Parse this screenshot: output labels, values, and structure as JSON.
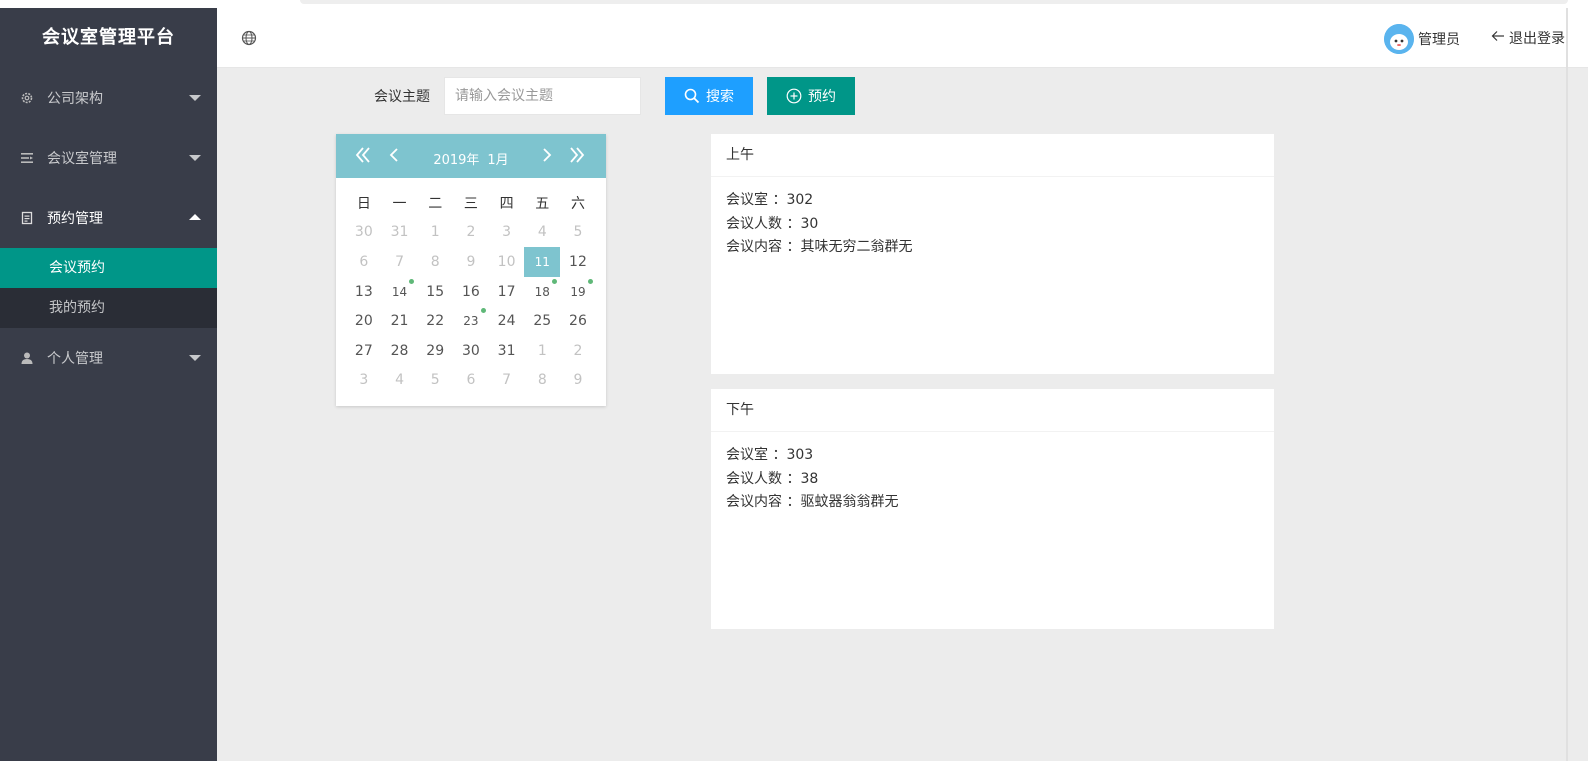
{
  "app": {
    "title": "会议室管理平台"
  },
  "sidebar": {
    "items": [
      {
        "label": "公司架构",
        "icon": "gear-icon"
      },
      {
        "label": "会议室管理",
        "icon": "list-icon"
      },
      {
        "label": "预约管理",
        "icon": "clipboard-icon",
        "expanded": true,
        "children": [
          {
            "label": "会议预约",
            "selected": true
          },
          {
            "label": "我的预约"
          }
        ]
      },
      {
        "label": "个人管理",
        "icon": "user-icon"
      }
    ]
  },
  "header": {
    "globe_icon": "globe-icon",
    "user_name": "管理员",
    "logout_label": "退出登录",
    "logout_icon": "arrow-left-icon"
  },
  "search": {
    "label": "会议主题",
    "placeholder": "请输入会议主题",
    "search_button": "搜索",
    "book_button": "预约"
  },
  "calendar": {
    "year": "2019年",
    "month": "1月",
    "weekdays": [
      "日",
      "一",
      "二",
      "三",
      "四",
      "五",
      "六"
    ],
    "weeks": [
      [
        "30",
        "31",
        "1",
        "2",
        "3",
        "4",
        "5"
      ],
      [
        "6",
        "7",
        "8",
        "9",
        "10",
        "11",
        "12"
      ],
      [
        "13",
        "14",
        "15",
        "16",
        "17",
        "18",
        "19"
      ],
      [
        "20",
        "21",
        "22",
        "23",
        "24",
        "25",
        "26"
      ],
      [
        "27",
        "28",
        "29",
        "30",
        "31",
        "1",
        "2"
      ],
      [
        "3",
        "4",
        "5",
        "6",
        "7",
        "8",
        "9"
      ]
    ],
    "selected_day": "11",
    "marked_days": [
      "14",
      "18",
      "19",
      "23"
    ],
    "colors": {
      "header": "#7ec4cf",
      "marker": "#5fb878"
    }
  },
  "meetings": {
    "am": {
      "title": "上午",
      "room_label": "会议室 ：",
      "room": "302",
      "people_label": "会议人数 ：",
      "people": "30",
      "content_label": "会议内容 ：",
      "content": "其味无穷二翁群无"
    },
    "pm": {
      "title": "下午",
      "room_label": "会议室 ：",
      "room": "303",
      "people_label": "会议人数 ：",
      "people": "38",
      "content_label": "会议内容 ：",
      "content": "驱蚊器翁翁群无"
    }
  },
  "colors": {
    "sidebar": "#393d49",
    "accent": "#009688",
    "primary": "#1e9fff"
  }
}
